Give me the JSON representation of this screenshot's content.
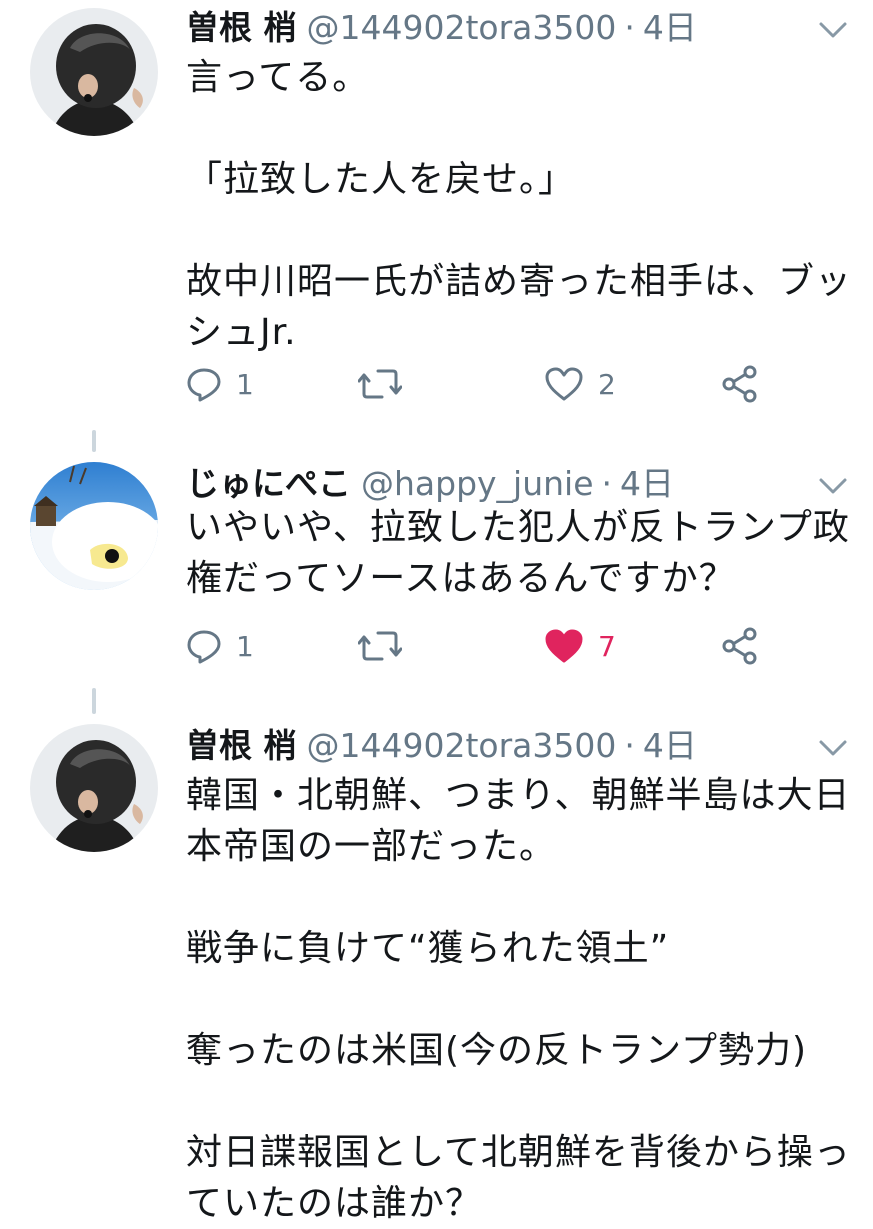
{
  "tweets": [
    {
      "name": "曽根 梢",
      "handle": "@144902tora3500",
      "separator": "·",
      "time": "4日",
      "lines": [
        "言ってる。",
        "",
        "「拉致した人を戻せ。」",
        "",
        "故中川昭一氏が詰め寄った相手は、ブッ",
        "シュJr."
      ],
      "reply_count": "1",
      "like_count": "2",
      "liked": false,
      "icons": [
        "reply-icon",
        "retweet-icon",
        "like-icon",
        "share-icon"
      ]
    },
    {
      "name": "じゅにぺこ",
      "handle": "@happy_junie",
      "separator": "·",
      "time": "4日",
      "lines": [
        "いやいや、拉致した犯人が反トランプ政",
        "権だってソースはあるんですか？"
      ],
      "reply_count": "1",
      "like_count": "7",
      "liked": true,
      "icons": [
        "reply-icon",
        "retweet-icon",
        "like-icon",
        "share-icon"
      ]
    },
    {
      "name": "曽根 梢",
      "handle": "@144902tora3500",
      "separator": "·",
      "time": "4日",
      "lines": [
        "韓国・北朝鮮、つまり、朝鮮半島は大日",
        "本帝国の一部だった。",
        "",
        "戦争に負けて“獲られた領土”",
        "",
        "奪ったのは米国(今の反トランプ勢力)",
        "",
        "対日諜報国として北朝鮮を背後から操っ",
        "ていたのは誰か？"
      ]
    }
  ],
  "colors": {
    "text": "#14171a",
    "secondary": "#657786",
    "liked": "#e0245e",
    "thread_line": "#ccd6dd"
  }
}
